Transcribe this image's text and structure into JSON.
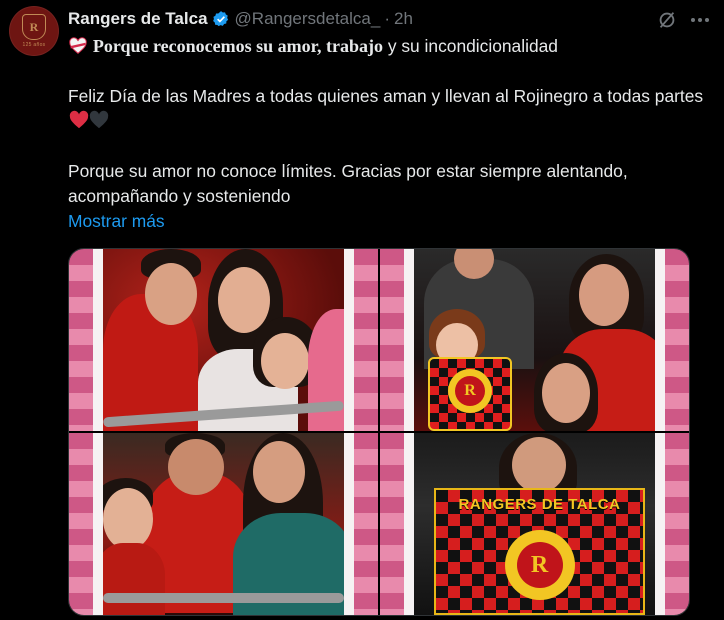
{
  "account": {
    "display_name": "Rangers de Talca",
    "handle": "@Rangersdetalca_",
    "separator": "·",
    "time": "2h",
    "avatar_years_text": "125 años",
    "avatar_crest_letter": "R"
  },
  "post": {
    "line1_bold": "Porque reconocemos su amor, trabajo",
    "line1_rest": " y su incondicionalidad",
    "paragraph2_text": "Feliz Día de las Madres a todas quienes aman y llevan al Rojinegro a todas partes ",
    "paragraph3": "Porque su amor no conoce límites. Gracias por estar siempre alentando, acompañando y sosteniendo",
    "show_more": "Mostrar más",
    "emojis": [
      "white-heart-ribbon-icon",
      "red-heart-icon",
      "black-heart-icon"
    ]
  },
  "media": {
    "banner_text": "RANGERS DE TALCA",
    "crest_letter": "R",
    "images": [
      {
        "description_key": "photo-1"
      },
      {
        "description_key": "photo-2"
      },
      {
        "description_key": "photo-3"
      },
      {
        "description_key": "photo-4"
      }
    ]
  },
  "colors": {
    "background": "#000000",
    "text": "#e7e9ea",
    "muted": "#71767b",
    "link": "#1d9bf0",
    "verified": "#1d9bf0",
    "frame_pink": "#ce5886",
    "club_red": "#c0141a",
    "club_gold": "#f2c623"
  }
}
